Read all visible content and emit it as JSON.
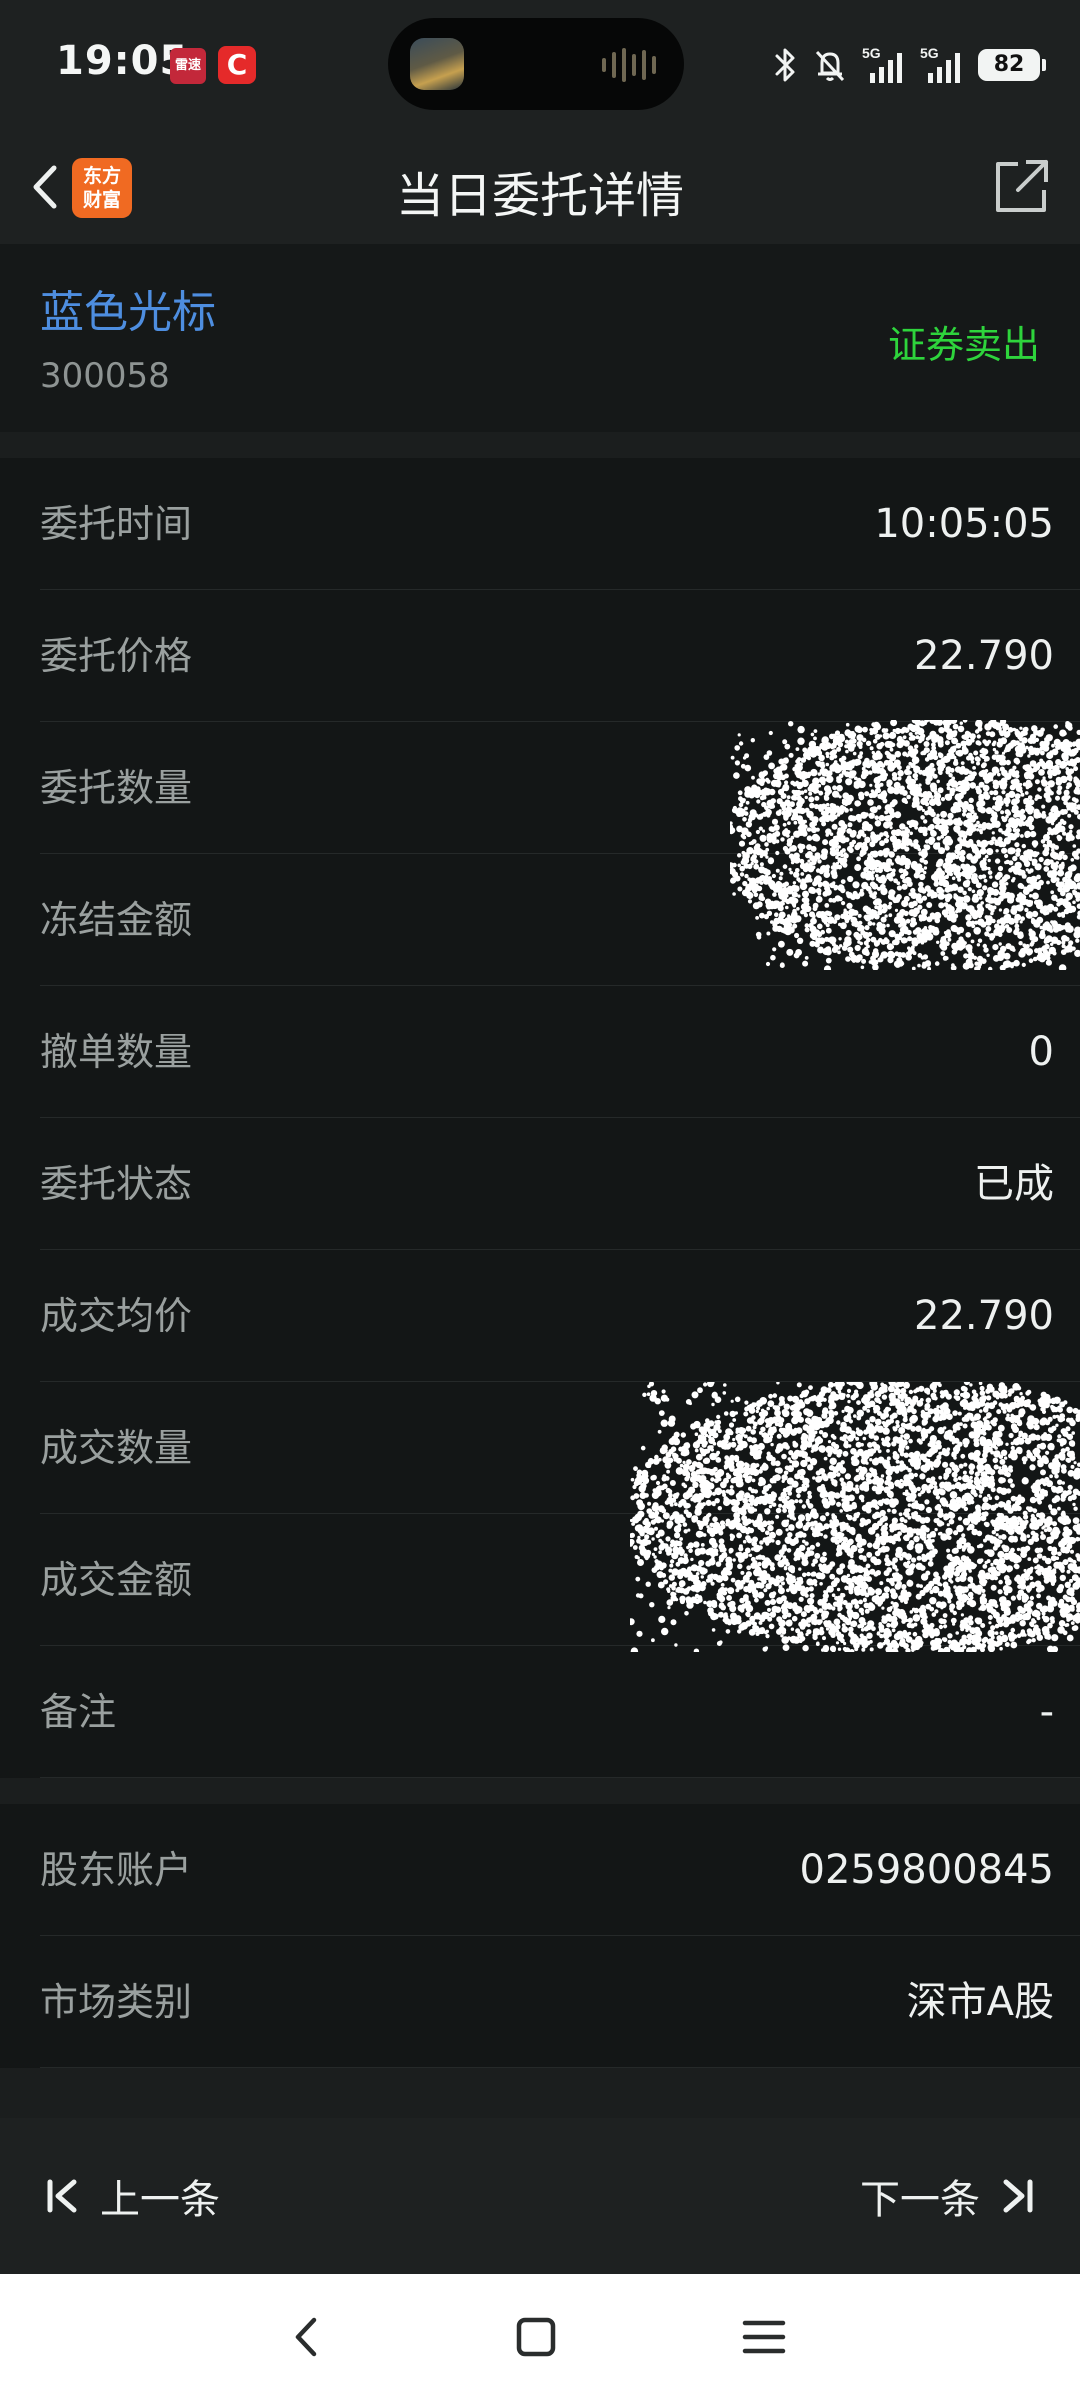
{
  "status_bar": {
    "time": "19:05",
    "app1_badge": "雷速",
    "app2_badge": "C",
    "battery": "82"
  },
  "header": {
    "logo_text": "东方\n财富",
    "title": "当日委托详情"
  },
  "stock": {
    "name": "蓝色光标",
    "code": "300058",
    "trade_type": "证券卖出"
  },
  "details": [
    {
      "label": "委托时间",
      "value": "10:05:05"
    },
    {
      "label": "委托价格",
      "value": "22.790"
    },
    {
      "label": "委托数量",
      "value": ""
    },
    {
      "label": "冻结金额",
      "value": ""
    },
    {
      "label": "撤单数量",
      "value": "0"
    },
    {
      "label": "委托状态",
      "value": "已成"
    },
    {
      "label": "成交均价",
      "value": "22.790"
    },
    {
      "label": "成交数量",
      "value": ""
    },
    {
      "label": "成交金额",
      "value": ""
    },
    {
      "label": "备注",
      "value": "-"
    }
  ],
  "account": [
    {
      "label": "股东账户",
      "value": "0259800845"
    },
    {
      "label": "市场类别",
      "value": "深市A股"
    }
  ],
  "pager": {
    "prev_label": "上一条",
    "next_label": "下一条"
  },
  "colors": {
    "background": "#1b1e1e",
    "stock_name": "#4e8ee0",
    "trade_type": "#2ed43c",
    "logo": "#f06a22"
  },
  "icons": {
    "back": "chevron-left-icon",
    "share": "share-external-icon",
    "prev": "skip-first-icon",
    "next": "skip-last-icon"
  }
}
